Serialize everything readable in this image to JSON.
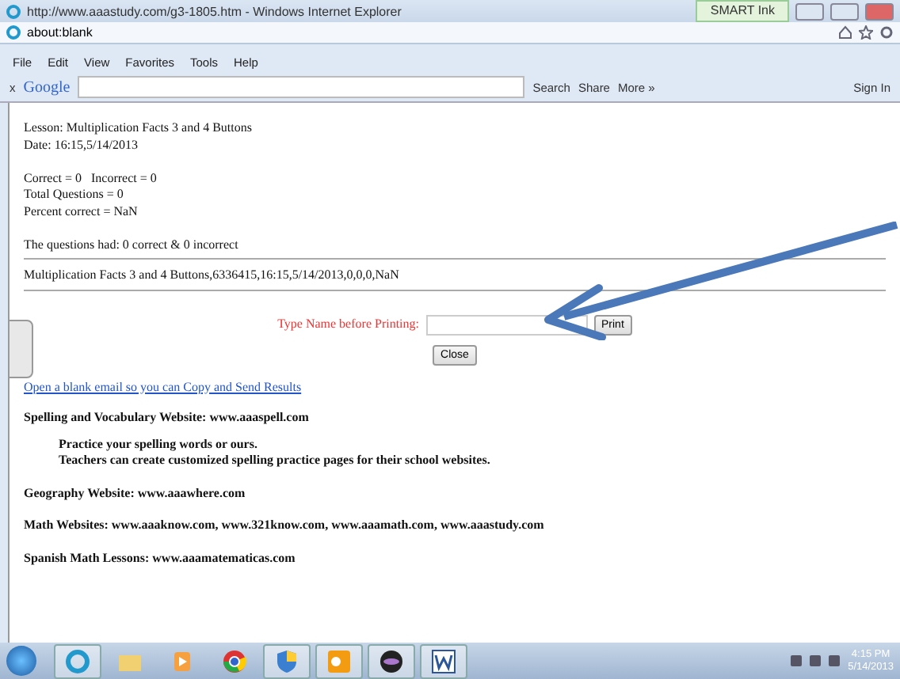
{
  "window": {
    "title": "http://www.aaastudy.com/g3-1805.htm - Windows Internet Explorer",
    "smart_ink": "SMART Ink"
  },
  "address_bar": {
    "url": "about:blank"
  },
  "menu": [
    "File",
    "Edit",
    "View",
    "Favorites",
    "Tools",
    "Help"
  ],
  "google_toolbar": {
    "close": "x",
    "logo": "Google",
    "search": "Search",
    "share": "Share",
    "more": "More »",
    "sign_in": "Sign In"
  },
  "report": {
    "lines_1": [
      "Lesson: Multiplication Facts 3 and 4 Buttons",
      "Date: 16:15,5/14/2013"
    ],
    "lines_2": [
      "Correct = 0   Incorrect = 0",
      "Total Questions = 0",
      "Percent correct = NaN"
    ],
    "summary": "The questions had: 0 correct & 0 incorrect",
    "record": "Multiplication Facts 3 and 4 Buttons,6336415,16:15,5/14/2013,0,0,0,NaN"
  },
  "print_form": {
    "label": "Type Name before Printing:",
    "print_button": "Print",
    "close_button": "Close"
  },
  "email_link": "Open a blank email so you can Copy and Send Results",
  "websites": [
    {
      "text": "Spelling and Vocabulary Website: www.aaaspell.com",
      "notes": [
        "Practice your spelling words or ours.",
        "Teachers can create customized spelling practice pages for their school websites."
      ]
    },
    {
      "text": "Geography Website: www.aaawhere.com"
    },
    {
      "text": "Math Websites: www.aaaknow.com, www.321know.com, www.aaamath.com, www.aaastudy.com"
    },
    {
      "text": "Spanish Math Lessons: www.aaamatematicas.com"
    }
  ],
  "taskbar": {
    "apps": [
      {
        "kind": "ie",
        "selected": true
      },
      {
        "kind": "folder",
        "selected": false
      },
      {
        "kind": "media",
        "selected": false
      },
      {
        "kind": "chrome",
        "selected": false
      },
      {
        "kind": "shield",
        "selected": true
      },
      {
        "kind": "outlook",
        "selected": true
      },
      {
        "kind": "disc",
        "selected": true
      },
      {
        "kind": "word",
        "selected": true
      }
    ],
    "time": "4:15 PM",
    "date": "5/14/2013"
  }
}
